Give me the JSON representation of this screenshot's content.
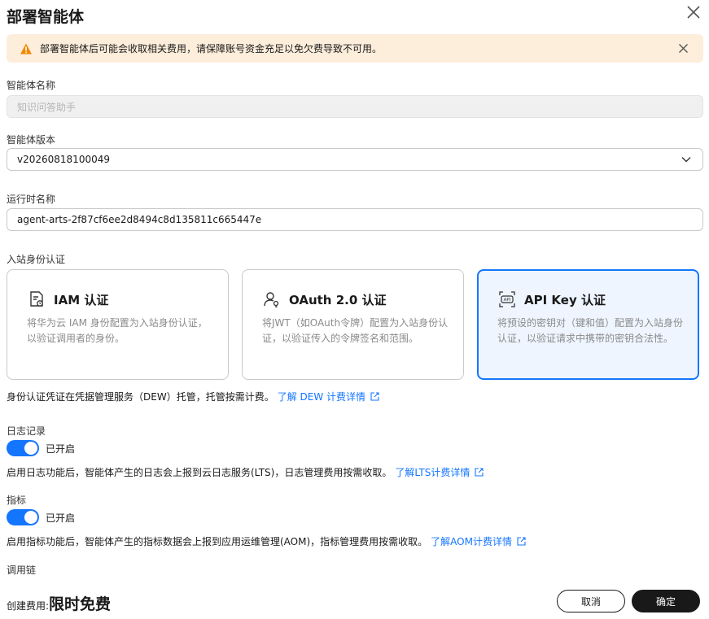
{
  "dialog": {
    "title": "部署智能体"
  },
  "alert": {
    "text": "部署智能体后可能会收取相关费用，请保障账号资金充足以免欠费导致不可用。"
  },
  "form": {
    "agent_name_label": "智能体名称",
    "agent_name_value": "知识问答助手",
    "version_label": "智能体版本",
    "version_value": "v20260818100049",
    "runtime_label": "运行时名称",
    "runtime_value": "agent-arts-2f87cf6ee2d8494c8d135811c665447e",
    "auth_label": "入站身份认证"
  },
  "auth_cards": [
    {
      "title": "IAM 认证",
      "desc": "将华为云 IAM 身份配置为入站身份认证，以验证调用者的身份。",
      "icon": "iam-doc-icon",
      "selected": false
    },
    {
      "title": "OAuth 2.0 认证",
      "desc": "将JWT（如OAuth令牌）配置为入站身份认证，以验证传入的令牌签名和范围。",
      "icon": "user-key-icon",
      "selected": false
    },
    {
      "title": "API Key 认证",
      "desc": "将预设的密钥对（键和值）配置为入站身份认证，以验证请求中携带的密钥合法性。",
      "icon": "api-icon",
      "selected": true
    }
  ],
  "dew_note": {
    "text": "身份认证凭证在凭据管理服务（DEW）托管，托管按需计费。",
    "link": "了解 DEW 计费详情"
  },
  "logging": {
    "label": "日志记录",
    "toggle_text": "已开启",
    "enabled": true,
    "note": "启用日志功能后，智能体产生的日志会上报到云日志服务(LTS)，日志管理费用按需收取。",
    "link": "了解LTS计费详情"
  },
  "metrics": {
    "label": "指标",
    "toggle_text": "已开启",
    "enabled": true,
    "note": "启用指标功能后，智能体产生的指标数据会上报到应用运维管理(AOM)，指标管理费用按需收取。",
    "link": "了解AOM计费详情"
  },
  "tracing": {
    "label": "调用链"
  },
  "footer": {
    "price_label": "创建费用:",
    "price_value": "限时免费",
    "cancel_label": "取消",
    "ok_label": "确定"
  },
  "colors": {
    "accent": "#1476ff",
    "alert_bg": "#fdeedb",
    "warning": "#f08a00"
  }
}
